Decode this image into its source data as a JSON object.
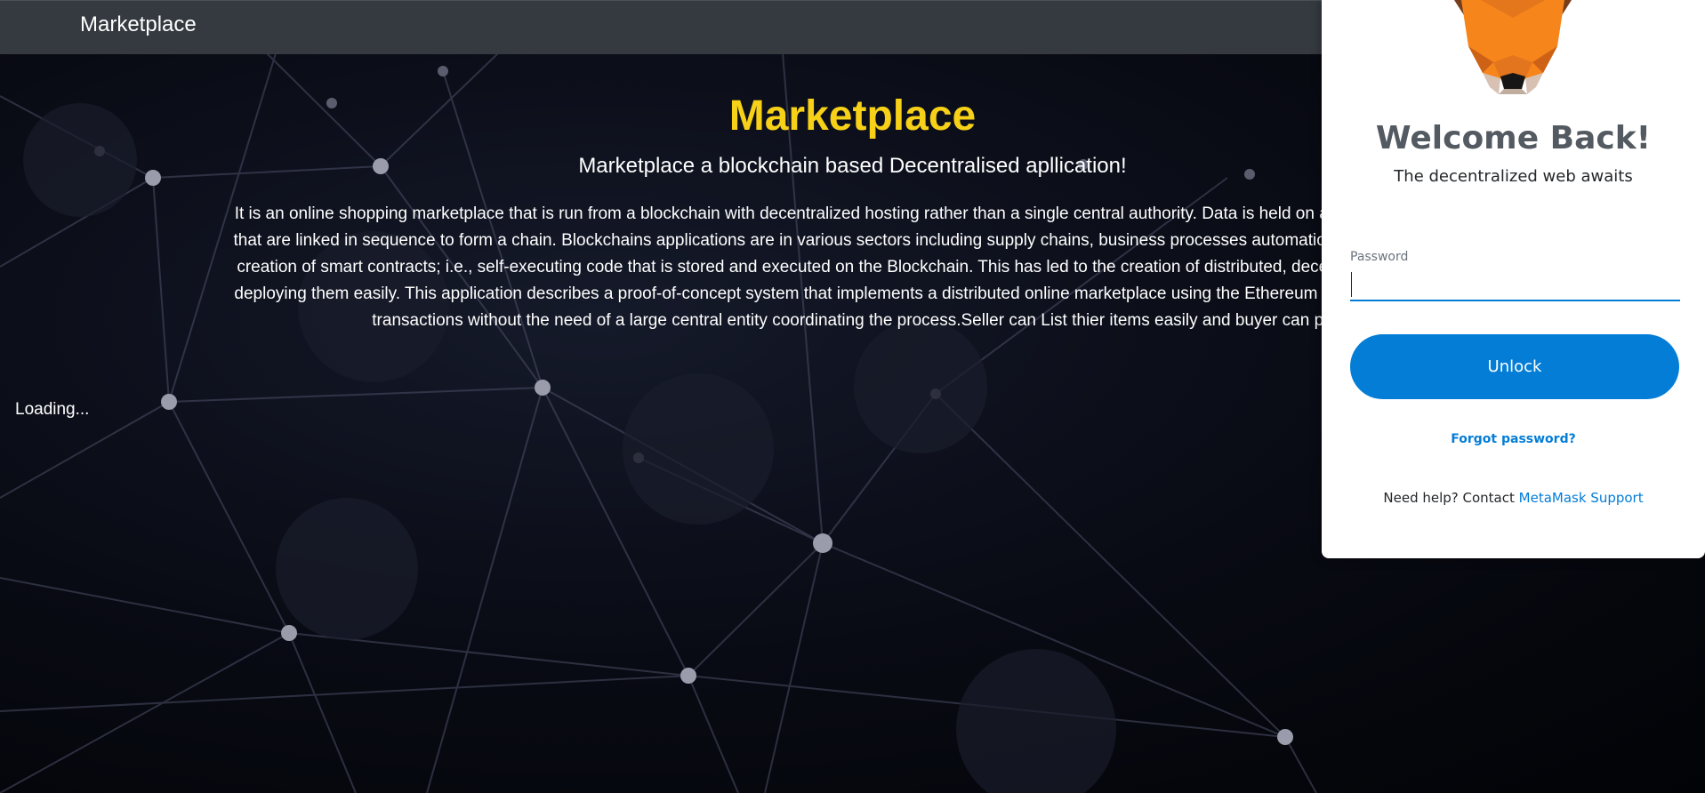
{
  "navbar": {
    "brand": "Marketplace"
  },
  "hero": {
    "title": "Marketplace",
    "subtitle": "Marketplace a blockchain based Decentralised apllication!",
    "lines": [
      "It is an online shopping marketplace that is run from a blockchain with decentralized hosting rather than a single central authority. Data is held on a set of decentralize",
      "that are linked in sequence to form a chain. Blockchains applications are in various sectors including supply chains, business processes automation, etc. Developmen",
      "creation of smart contracts; i.e., self-executing code that is stored and executed on the Blockchain. This has led to the creation of distributed, decentralised applicatio",
      "deploying them easily. This application describes a proof-of-concept system that implements a distributed online marketplace using the Ethereum framework, where b",
      "transactions without the need of a large central entity coordinating the process.Seller can List thier items easily and buyer can pu"
    ]
  },
  "status": {
    "loading": "Loading..."
  },
  "metamask": {
    "title": "Welcome Back!",
    "subtitle": "The decentralized web awaits",
    "password_label": "Password",
    "password_value": "",
    "unlock_label": "Unlock",
    "forgot_label": "Forgot password?",
    "help_prefix": "Need help? Contact",
    "help_link": "MetaMask Support",
    "colors": {
      "accent": "#037dd6",
      "fox": "#f6851b"
    }
  },
  "colors": {
    "hero_title": "#f7d117",
    "navbar": "#343a40"
  }
}
